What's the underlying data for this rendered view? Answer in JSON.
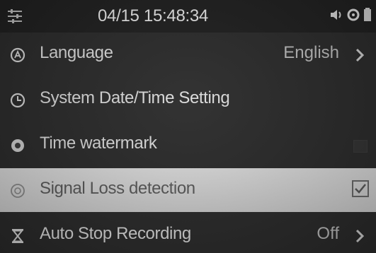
{
  "status": {
    "datetime": "04/15 15:48:34",
    "icons": [
      "menu-icon",
      "speaker-icon",
      "record-indicator-icon",
      "battery-icon"
    ]
  },
  "menu": {
    "items": [
      {
        "label": "Language",
        "value": "English",
        "icon": "language-icon",
        "has_arrow": true
      },
      {
        "label": "System Date/Time Setting",
        "icon": "clock-icon"
      },
      {
        "label": "Time watermark",
        "icon": "watermark-icon"
      },
      {
        "label": "Signal Loss detection",
        "icon": "signal-icon",
        "selected": true,
        "checked": true
      },
      {
        "label": "Auto Stop Recording",
        "value": "Off",
        "icon": "hourglass-icon",
        "has_arrow": true
      }
    ]
  }
}
